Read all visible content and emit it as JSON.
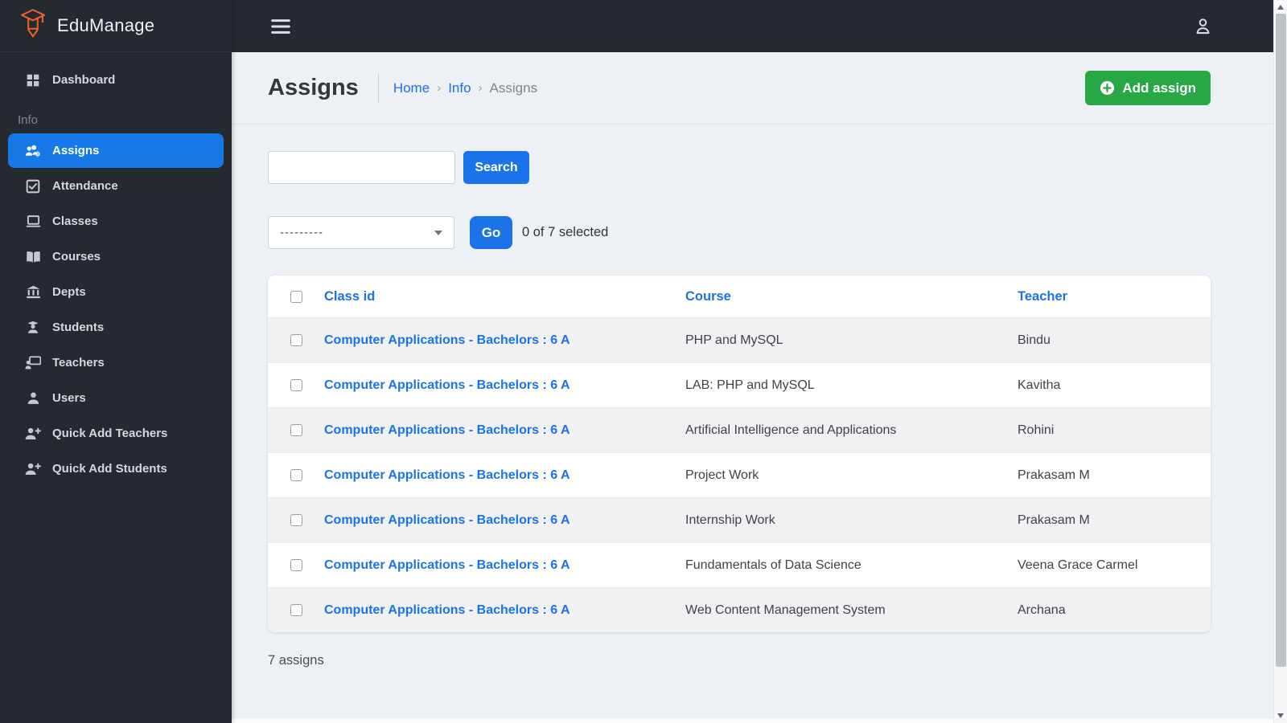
{
  "brand": {
    "name": "EduManage"
  },
  "sidebar": {
    "dashboard_label": "Dashboard",
    "section_label": "Info",
    "items": [
      {
        "label": "Assigns",
        "icon": "users-gear-icon",
        "active": true
      },
      {
        "label": "Attendance",
        "icon": "check-square-icon",
        "active": false
      },
      {
        "label": "Classes",
        "icon": "laptop-icon",
        "active": false
      },
      {
        "label": "Courses",
        "icon": "book-open-icon",
        "active": false
      },
      {
        "label": "Depts",
        "icon": "bank-icon",
        "active": false
      },
      {
        "label": "Students",
        "icon": "graduate-icon",
        "active": false
      },
      {
        "label": "Teachers",
        "icon": "teacher-board-icon",
        "active": false
      },
      {
        "label": "Users",
        "icon": "person-icon",
        "active": false
      },
      {
        "label": "Quick Add Teachers",
        "icon": "person-plus-icon",
        "active": false
      },
      {
        "label": "Quick Add Students",
        "icon": "person-plus-icon",
        "active": false
      }
    ]
  },
  "header": {
    "title": "Assigns",
    "breadcrumb": {
      "home": "Home",
      "section": "Info",
      "current": "Assigns",
      "separator": "›"
    },
    "add_button_label": "Add assign"
  },
  "toolbar": {
    "search_value": "",
    "search_button_label": "Search",
    "action_select_value": "---------",
    "go_button_label": "Go",
    "selection_status": "0 of 7 selected"
  },
  "table": {
    "headers": {
      "class_id": "Class id",
      "course": "Course",
      "teacher": "Teacher"
    },
    "rows": [
      {
        "class_id": "Computer Applications - Bachelors : 6 A",
        "course": "PHP and MySQL",
        "teacher": "Bindu"
      },
      {
        "class_id": "Computer Applications - Bachelors : 6 A",
        "course": "LAB: PHP and MySQL",
        "teacher": "Kavitha"
      },
      {
        "class_id": "Computer Applications - Bachelors : 6 A",
        "course": "Artificial Intelligence and Applications",
        "teacher": "Rohini"
      },
      {
        "class_id": "Computer Applications - Bachelors : 6 A",
        "course": "Project Work",
        "teacher": "Prakasam M"
      },
      {
        "class_id": "Computer Applications - Bachelors : 6 A",
        "course": "Internship Work",
        "teacher": "Prakasam M"
      },
      {
        "class_id": "Computer Applications - Bachelors : 6 A",
        "course": "Fundamentals of Data Science",
        "teacher": "Veena Grace Carmel"
      },
      {
        "class_id": "Computer Applications - Bachelors : 6 A",
        "course": "Web Content Management System",
        "teacher": "Archana"
      }
    ],
    "footer_count": "7 assigns"
  },
  "colors": {
    "accent_blue": "#1a73e8",
    "selected_blue": "#1778e8",
    "success_green": "#28a745",
    "sidebar_dark": "#252a31",
    "brand_orange": "#f2602a",
    "main_bg": "#edf0f4",
    "stripe_row": "#f1f1f3"
  }
}
